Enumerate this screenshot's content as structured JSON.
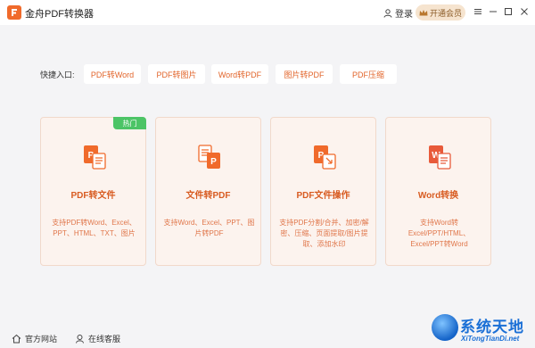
{
  "window": {
    "title": "金舟PDF转换器",
    "login_label": "登录",
    "vip_label": "开通会员",
    "controls": [
      "minimize",
      "maximize",
      "close",
      "menu"
    ]
  },
  "quick_entry": {
    "label": "快捷入口:",
    "items": [
      {
        "label": "PDF转Word"
      },
      {
        "label": "PDF转图片"
      },
      {
        "label": "Word转PDF"
      },
      {
        "label": "图片转PDF"
      },
      {
        "label": "PDF压缩"
      }
    ]
  },
  "cards": [
    {
      "title": "PDF转文件",
      "desc": "支持PDF转Word、Excel、PPT、HTML、TXT、图片",
      "badge": "热门",
      "icon": "pdf-to-file-icon"
    },
    {
      "title": "文件转PDF",
      "desc": "支持Word、Excel、PPT、图片转PDF",
      "badge": "",
      "icon": "file-to-pdf-icon"
    },
    {
      "title": "PDF文件操作",
      "desc": "支持PDF分割/合并、加密/解密、压缩、页面提取/图片提取、添加水印",
      "badge": "",
      "icon": "pdf-operations-icon"
    },
    {
      "title": "Word转换",
      "desc": "支持Word转Excel/PPT/HTML、Excel/PPT转Word",
      "badge": "",
      "icon": "word-convert-icon"
    }
  ],
  "footer": {
    "website_label": "官方网站",
    "support_label": "在线客服"
  },
  "watermark": {
    "main": "系统天地",
    "sub": "XiTongTianDi.net"
  },
  "colors": {
    "accent": "#e2652b",
    "card_bg": "#fcf3ee",
    "badge": "#4cc466",
    "word_blue": "#e85a3a"
  }
}
